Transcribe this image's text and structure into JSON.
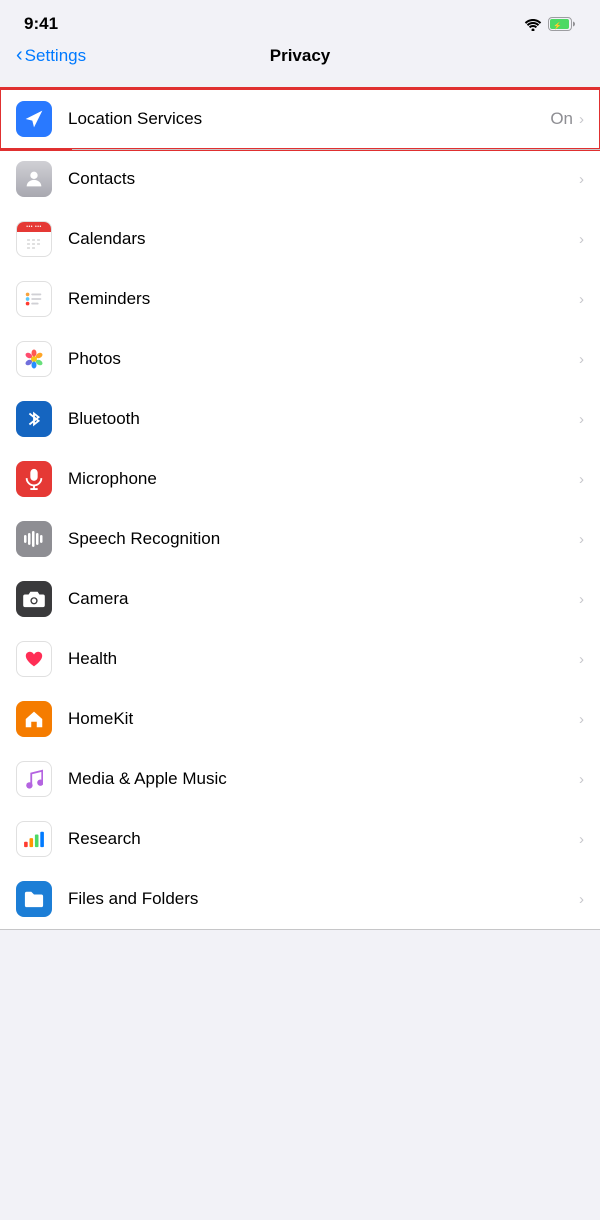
{
  "status_bar": {
    "time": "9:41",
    "wifi": "wifi-icon",
    "battery": "battery-icon"
  },
  "nav": {
    "back_label": "Settings",
    "title": "Privacy"
  },
  "rows": [
    {
      "id": "location-services",
      "label": "Location Services",
      "value": "On",
      "icon_bg": "blue",
      "highlighted": true
    },
    {
      "id": "contacts",
      "label": "Contacts",
      "value": "",
      "icon_bg": "gray",
      "highlighted": false
    },
    {
      "id": "calendars",
      "label": "Calendars",
      "value": "",
      "icon_bg": "white",
      "highlighted": false
    },
    {
      "id": "reminders",
      "label": "Reminders",
      "value": "",
      "icon_bg": "white",
      "highlighted": false
    },
    {
      "id": "photos",
      "label": "Photos",
      "value": "",
      "icon_bg": "white",
      "highlighted": false
    },
    {
      "id": "bluetooth",
      "label": "Bluetooth",
      "value": "",
      "icon_bg": "blue-dark",
      "highlighted": false
    },
    {
      "id": "microphone",
      "label": "Microphone",
      "value": "",
      "icon_bg": "red",
      "highlighted": false
    },
    {
      "id": "speech-recognition",
      "label": "Speech Recognition",
      "value": "",
      "icon_bg": "gray",
      "highlighted": false
    },
    {
      "id": "camera",
      "label": "Camera",
      "value": "",
      "icon_bg": "dark-gray",
      "highlighted": false
    },
    {
      "id": "health",
      "label": "Health",
      "value": "",
      "icon_bg": "white",
      "highlighted": false
    },
    {
      "id": "homekit",
      "label": "HomeKit",
      "value": "",
      "icon_bg": "orange",
      "highlighted": false
    },
    {
      "id": "media-apple-music",
      "label": "Media & Apple Music",
      "value": "",
      "icon_bg": "white",
      "highlighted": false
    },
    {
      "id": "research",
      "label": "Research",
      "value": "",
      "icon_bg": "white",
      "highlighted": false
    },
    {
      "id": "files-and-folders",
      "label": "Files and Folders",
      "value": "",
      "icon_bg": "blue",
      "highlighted": false
    }
  ]
}
